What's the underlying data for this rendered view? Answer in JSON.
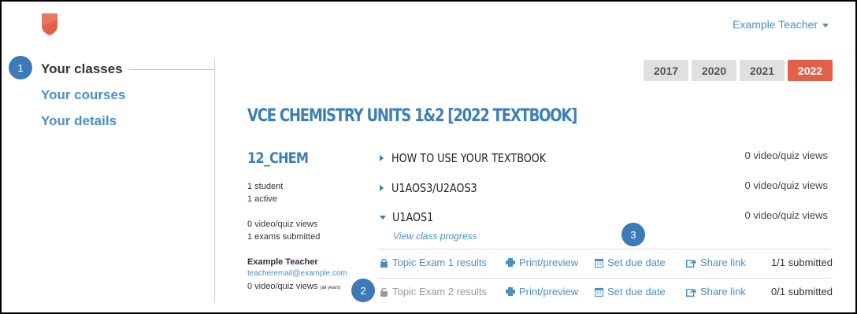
{
  "header": {
    "user_label": "Example Teacher"
  },
  "sidebar": {
    "items": [
      {
        "label": "Your classes"
      },
      {
        "label": "Your courses"
      },
      {
        "label": "Your details"
      }
    ]
  },
  "badges": [
    "1",
    "2",
    "3"
  ],
  "year_tabs": [
    {
      "label": "2017"
    },
    {
      "label": "2020"
    },
    {
      "label": "2021"
    },
    {
      "label": "2022"
    }
  ],
  "course": {
    "title": "VCE CHEMISTRY UNITS 1&2 [2022 TEXTBOOK]"
  },
  "class_info": {
    "name": "12_CHEM",
    "students": "1 student",
    "active": "1 active",
    "views": "0 video/quiz views",
    "exams": "1 exams submitted",
    "teacher_name": "Example Teacher",
    "teacher_email": "teacheremail@example.com",
    "teacher_views": "0 video/quiz views",
    "teacher_views_note": "(all years)"
  },
  "topics": [
    {
      "label": "HOW TO USE YOUR TEXTBOOK",
      "views": "0 video/quiz views"
    },
    {
      "label": "U1AOS3/U2AOS3",
      "views": "0 video/quiz views"
    },
    {
      "label": "U1AOS1",
      "views": "0 video/quiz views"
    }
  ],
  "view_progress_label": "View class progress",
  "exams": [
    {
      "label": "Topic Exam 1 results",
      "print": "Print/preview",
      "due": "Set due date",
      "share": "Share link",
      "submitted": "1/1 submitted"
    },
    {
      "label": "Topic Exam 2 results",
      "print": "Print/preview",
      "due": "Set due date",
      "share": "Share link",
      "submitted": "0/1 submitted"
    }
  ],
  "colors": {
    "accent": "#4a8fc4",
    "active_tab": "#e2604a",
    "badge": "#3d7ab8",
    "logo": "#e2604a"
  }
}
